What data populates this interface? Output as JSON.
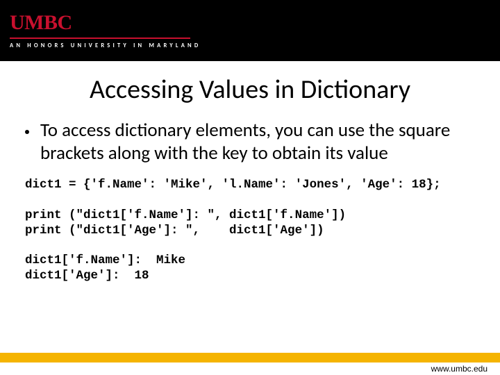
{
  "logo": {
    "text": "UMBC",
    "tagline": "AN HONORS UNIVERSITY IN MARYLAND"
  },
  "title": "Accessing Values in Dictionary",
  "bullet": "To access dictionary elements, you can use the square brackets along with the key to obtain its value",
  "code_block": "dict1 = {'f.Name': 'Mike', 'l.Name': 'Jones', 'Age': 18};\n\nprint (\"dict1['f.Name']: \", dict1['f.Name'])\nprint (\"dict1['Age']: \",    dict1['Age'])",
  "output_block": "dict1['f.Name']:  Mike\ndict1['Age']:  18",
  "footer_url": "www.umbc.edu"
}
